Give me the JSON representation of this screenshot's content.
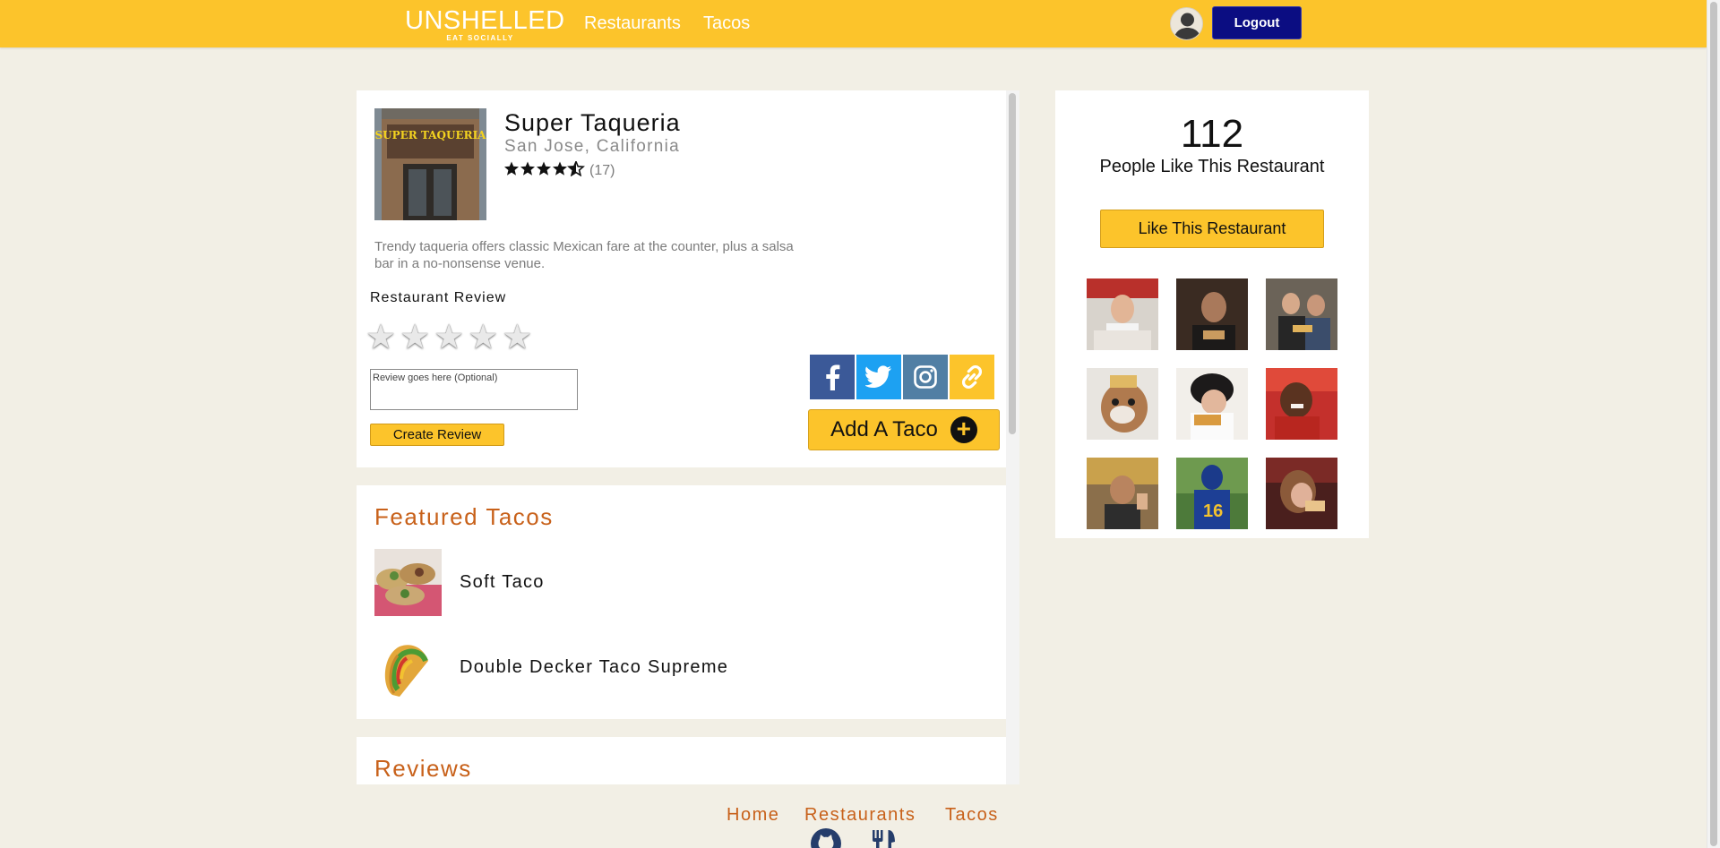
{
  "navbar": {
    "brand": "UNSHELLED",
    "tagline": "EAT SOCIALLY",
    "links": [
      "Restaurants",
      "Tacos"
    ],
    "logout_label": "Logout",
    "color": "#fcc42b"
  },
  "restaurant": {
    "name": "Super Taqueria",
    "location": "San Jose, California",
    "rating_value": 4.5,
    "rating_count": "(17)",
    "photo_sign": "SUPER TAQUERIA",
    "description": "Trendy taqueria offers classic Mexican fare at the counter, plus a salsa bar in a no-nonsense venue."
  },
  "review_form": {
    "heading": "Restaurant Review",
    "placeholder": "Review goes here (Optional)",
    "submit_label": "Create Review"
  },
  "share": {
    "buttons": [
      "facebook-icon",
      "twitter-icon",
      "instagram-icon",
      "link-icon"
    ],
    "colors": [
      "#3b5998",
      "#1da1f2",
      "#517fa4",
      "#fcc42b"
    ]
  },
  "add_taco": {
    "label": "Add A Taco"
  },
  "featured": {
    "title": "Featured Tacos",
    "items": [
      "Soft Taco",
      "Double Decker Taco Supreme"
    ]
  },
  "reviews": {
    "title": "Reviews"
  },
  "likes": {
    "count": "112",
    "text": "People Like This Restaurant",
    "button_label": "Like This Restaurant"
  },
  "footer": {
    "links": [
      "Home",
      "Restaurants",
      "Tacos"
    ],
    "icons": [
      "github-icon",
      "utensils-icon"
    ]
  },
  "colors": {
    "accent": "#fcc42b",
    "logout": "#0b0d82",
    "heading": "#c8611a",
    "background": "#f2efe5"
  }
}
